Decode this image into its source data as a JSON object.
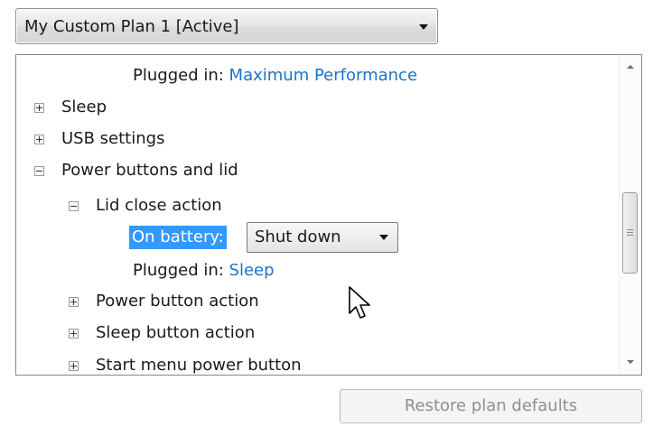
{
  "plan_dropdown": {
    "selected": "My Custom Plan 1 [Active]"
  },
  "tree": {
    "top_plugged_in": {
      "label": "Plugged in:",
      "value": "Maximum Performance"
    },
    "items": [
      {
        "label": "Sleep",
        "expander": "+"
      },
      {
        "label": "USB settings",
        "expander": "+"
      },
      {
        "label": "Power buttons and lid",
        "expander": "−"
      }
    ],
    "lid_close_action": {
      "label": "Lid close action",
      "expander": "−",
      "on_battery_label": "On battery:",
      "on_battery_value": "Shut down",
      "plugged_in_label": "Plugged in:",
      "plugged_in_value": "Sleep"
    },
    "sub_items": [
      {
        "label": "Power button action",
        "expander": "+"
      },
      {
        "label": "Sleep button action",
        "expander": "+"
      },
      {
        "label": "Start menu power button",
        "expander": "+"
      }
    ]
  },
  "footer": {
    "restore_button": "Restore plan defaults"
  },
  "icons": {
    "dropdown": "chevron-down-icon",
    "expand": "plus-box-icon",
    "collapse": "minus-box-icon",
    "scroll_up": "scroll-up-icon",
    "scroll_down": "scroll-down-icon",
    "cursor": "mouse-pointer-icon"
  },
  "colors": {
    "link": "#1b73c9",
    "selection": "#3399ff",
    "disabled_text": "#8f8f8f"
  }
}
